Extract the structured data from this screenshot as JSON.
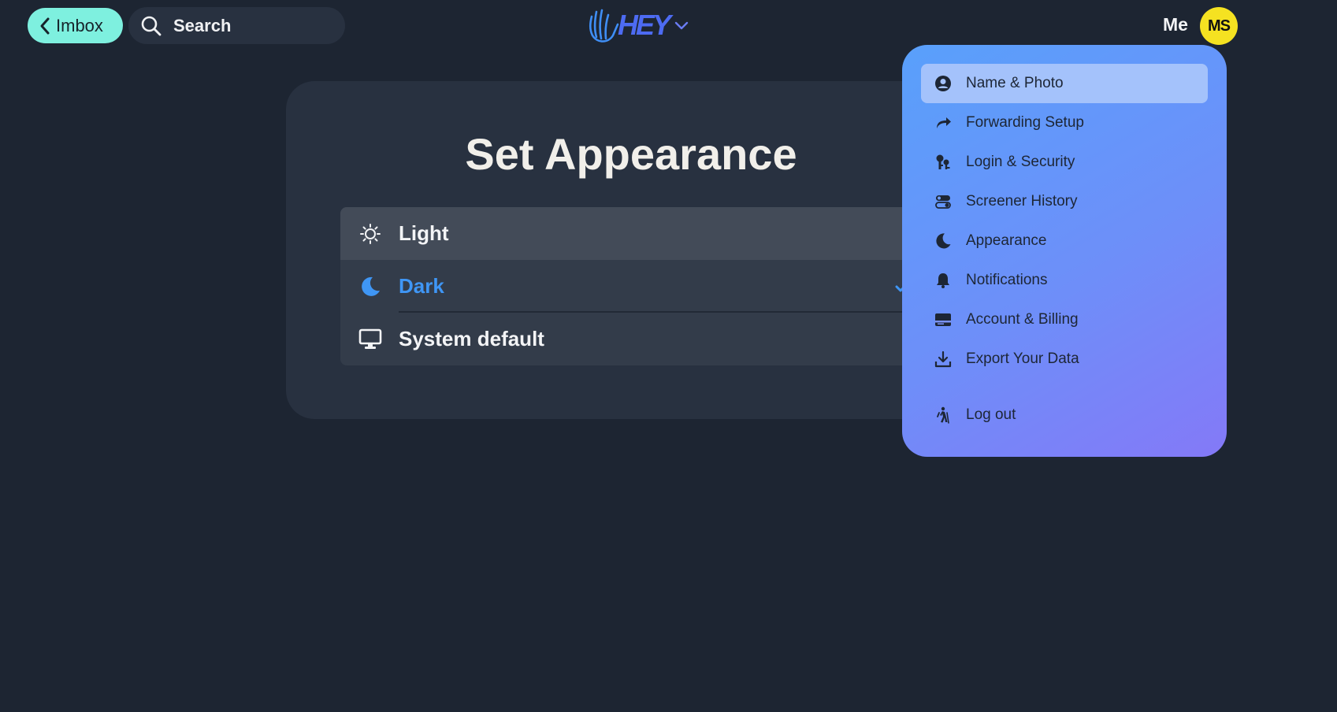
{
  "topbar": {
    "back_label": "Imbox",
    "search_label": "Search",
    "logo_text": "HEY",
    "me_label": "Me",
    "avatar_initials": "MS"
  },
  "appearance": {
    "title": "Set Appearance",
    "options": [
      {
        "label": "Light",
        "icon": "sun-icon",
        "hovered": true
      },
      {
        "label": "Dark",
        "icon": "moon-icon",
        "selected": true
      },
      {
        "label": "System default",
        "icon": "monitor-icon"
      }
    ]
  },
  "menu": {
    "items": [
      {
        "label": "Name & Photo",
        "icon": "user-circle-icon"
      },
      {
        "label": "Forwarding Setup",
        "icon": "forward-arrow-icon"
      },
      {
        "label": "Login & Security",
        "icon": "keys-icon"
      },
      {
        "label": "Screener History",
        "icon": "toggles-icon"
      },
      {
        "label": "Appearance",
        "icon": "moon-icon"
      },
      {
        "label": "Notifications",
        "icon": "bell-icon"
      },
      {
        "label": "Account & Billing",
        "icon": "credit-card-icon"
      },
      {
        "label": "Export Your Data",
        "icon": "download-icon"
      },
      {
        "label": "Log out",
        "icon": "hiker-icon"
      }
    ]
  },
  "colors": {
    "background": "#1d2532",
    "card": "#283140",
    "accent_blue": "#3f96f5",
    "imbox_button": "#7ef0df",
    "avatar": "#f5e221",
    "menu_gradient_start": "#59a0fb",
    "menu_gradient_end": "#8479f7"
  }
}
